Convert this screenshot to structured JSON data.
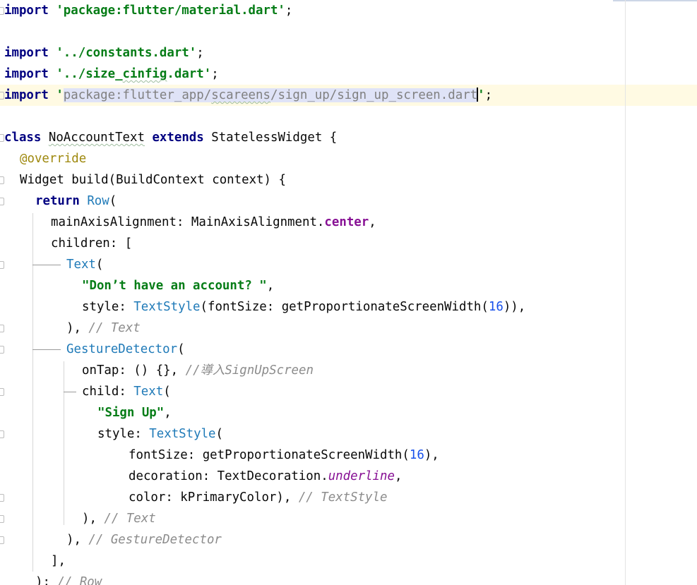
{
  "editor": {
    "imports": {
      "kw": "import",
      "material": "'package:flutter/material.dart'",
      "constants": "'../constants.dart'",
      "size_config_prefix": "'../size_",
      "size_config_typo": "cinfig",
      "size_config_suffix": ".dart'",
      "signup_quote_open": "'",
      "signup_path_a": "package:flutter_app/",
      "signup_path_typo": "scareens",
      "signup_path_b": "/sign_up/sign_up_screen.dart",
      "signup_quote_close": "'",
      "semicolon": ";"
    },
    "class_decl": {
      "kw_class": "class",
      "name": "NoAccountText",
      "kw_extends": "extends",
      "parent": "StatelessWidget",
      "brace": "{"
    },
    "override": "@override",
    "build_sig": "Widget build(BuildContext context) {",
    "return_kw": "return",
    "row": "Row",
    "main_axis_prefix": "mainAxisAlignment: MainAxisAlignment.",
    "main_axis_center": "center",
    "children_open": "children: [",
    "text_widget": "Text",
    "dont_have": "\"Don’t have an account? \"",
    "style_label": "style: ",
    "text_style": "TextStyle",
    "font_size_prefix": "(fontSize: getProportionateScreenWidth(",
    "font_size_value": "16",
    "font_size_suffix": ")),",
    "close_paren_comma": "), ",
    "cmt_text": "// Text",
    "gesture_detector": "GestureDetector",
    "on_tap": "onTap: () {}, ",
    "on_tap_comment": "//導入SignUpScreen",
    "child_label": "child: ",
    "sign_up": "\"Sign Up\"",
    "font_size_line_prefix": "fontSize: getProportionateScreenWidth(",
    "font_size_line_suffix": "),",
    "decoration_prefix": "decoration: TextDecoration.",
    "decoration_value": "underline",
    "color_line": "color: kPrimaryColor), ",
    "cmt_text_style": "// TextStyle",
    "cmt_gesture": "// GestureDetector",
    "children_close": "],",
    "cmt_row": "// Row",
    "row_close": "); "
  }
}
